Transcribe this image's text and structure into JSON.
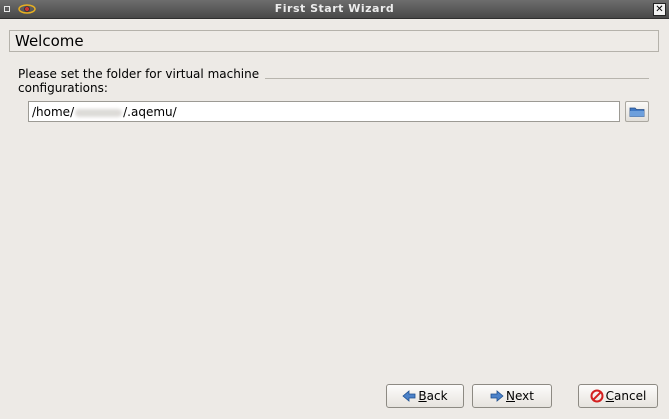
{
  "window": {
    "title": "First Start Wizard",
    "close_glyph": "✕"
  },
  "page": {
    "heading": "Welcome"
  },
  "folder_group": {
    "label": "Please set the folder for virtual machine configurations:",
    "path_prefix": "/home/",
    "path_suffix": "/.aqemu/"
  },
  "buttons": {
    "back": {
      "mnemonic": "B",
      "rest": "ack"
    },
    "next": {
      "mnemonic": "N",
      "rest": "ext"
    },
    "cancel": {
      "mnemonic": "C",
      "rest": "ancel"
    }
  },
  "icons": {
    "menu": "window-menu-icon",
    "app": "aqemu-app-icon",
    "close": "close-icon",
    "folder": "folder-icon",
    "back": "arrow-left-icon",
    "next": "arrow-right-icon",
    "cancel": "cancel-icon"
  },
  "colors": {
    "titlebar": "#575757",
    "window_bg": "#edeae6",
    "accent_blue": "#3f78c4",
    "cancel_red": "#d42020"
  }
}
